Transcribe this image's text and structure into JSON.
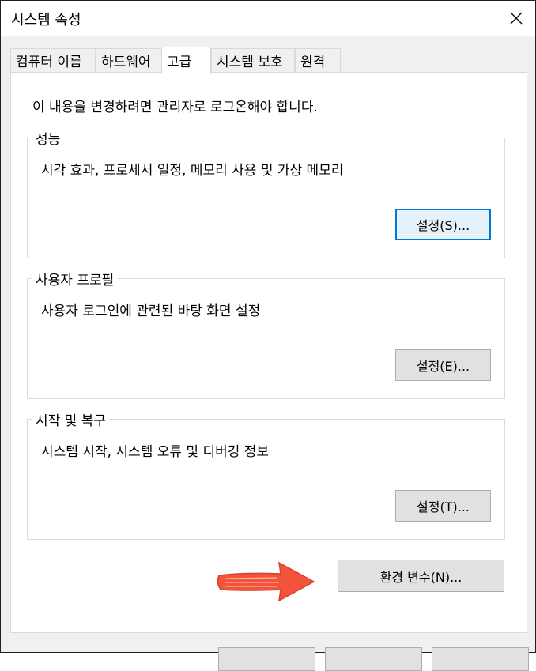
{
  "window": {
    "title": "시스템 속성",
    "close_icon": "close-icon"
  },
  "tabs": [
    {
      "label": "컴퓨터 이름"
    },
    {
      "label": "하드웨어"
    },
    {
      "label": "고급",
      "active": true
    },
    {
      "label": "시스템 보호"
    },
    {
      "label": "원격"
    }
  ],
  "panel": {
    "notice": "이 내용을 변경하려면 관리자로 로그온해야 합니다.",
    "groups": [
      {
        "label": "성능",
        "description": "시각 효과, 프로세서 일정, 메모리 사용 및 가상 메모리",
        "button": "설정(S)..."
      },
      {
        "label": "사용자 프로필",
        "description": "사용자 로그인에 관련된 바탕 화면 설정",
        "button": "설정(E)..."
      },
      {
        "label": "시작 및 복구",
        "description": "시스템 시작, 시스템 오류 및 디버깅 정보",
        "button": "설정(T)..."
      }
    ],
    "env_button": "환경 변수(N)...",
    "annotation_color": "#f2533b"
  }
}
